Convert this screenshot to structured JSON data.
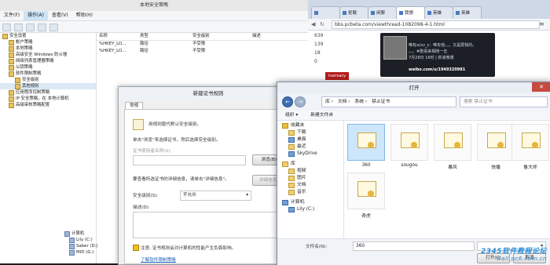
{
  "lsp": {
    "title": "本地安全策略",
    "menu": [
      "文件(F)",
      "操作(A)",
      "查看(V)",
      "帮助(H)"
    ],
    "tree": [
      {
        "label": "安全设置",
        "level": 0
      },
      {
        "label": "帐户策略",
        "level": 1
      },
      {
        "label": "本地策略",
        "level": 1
      },
      {
        "label": "高级安全 Windows 防火墙",
        "level": 1
      },
      {
        "label": "网络列表管理器策略",
        "level": 1
      },
      {
        "label": "公钥策略",
        "level": 1
      },
      {
        "label": "软件限制策略",
        "level": 1
      },
      {
        "label": "安全级别",
        "level": 2
      },
      {
        "label": "其他规则",
        "level": 2
      },
      {
        "label": "应用程序控制策略",
        "level": 1
      },
      {
        "label": "IP 安全策略，在 本地计算机",
        "level": 1
      },
      {
        "label": "高级审核策略配置",
        "level": 1
      }
    ],
    "columns": [
      "名称",
      "类型",
      "安全级别",
      "描述"
    ],
    "rows": [
      {
        "name": "%HKEY_LO...",
        "type": "路径",
        "level": "不受限",
        "desc": ""
      },
      {
        "name": "%HKEY_LO...",
        "type": "路径",
        "level": "不受限",
        "desc": ""
      }
    ],
    "left_tree_bottom": [
      "计算机",
      "Lily (C:)",
      "Saber (D:)",
      "MID (G:)"
    ]
  },
  "cert_rule_dialog": {
    "title": "新建证书规则",
    "tab": "常规",
    "intro": "用规则替代默认安全级别。",
    "hint": "单击\"浏览\"来选择证书，然后选择安全级别。",
    "subject_label": "证书使用者名称(U):",
    "browse_button": "浏览(B)...",
    "details_hint": "要查看所选证书的详细信息，请单击\"详细信息\"。",
    "details_button": "详细信息(S)",
    "level_label": "安全级别(S):",
    "level_value": "不允许",
    "desc_label": "描述(D):",
    "note": "注意: 证书规则会对计算机的性能产生负面影响。",
    "footer": "了解软件限制策略"
  },
  "browser": {
    "tabs": [
      "",
      "拒载",
      "闲聊",
      "我想",
      "英雄",
      "英雄"
    ],
    "url": "bbs.pcbeta.com/viewthread-1082098-4-1.html",
    "nums": [
      "639",
      "139",
      "18",
      "0"
    ],
    "banner_lines": [
      "唯有a(ov_s：唯有他。。。又是屏我的。",
      "。。。#剧看来相随一击",
      "7月28日 16时 | 新浪微博",
      "weibo.com/u/1949320981"
    ],
    "anniversary": "iversary"
  },
  "open_dialog": {
    "title": "打开",
    "breadcrumb": [
      "库",
      "文档",
      "系统",
      "禁止证书"
    ],
    "search_placeholder": "搜索 禁止证书",
    "organize": "组织 ▾",
    "new_folder": "新建文件夹",
    "nav": [
      {
        "label": "收藏夹",
        "icon": "star"
      },
      {
        "label": "下载",
        "icon": "folder"
      },
      {
        "label": "桌面",
        "icon": "blue"
      },
      {
        "label": "最近",
        "icon": "folder"
      },
      {
        "label": "SkyDrive",
        "icon": "blue"
      },
      {
        "label": "库",
        "icon": "folder"
      },
      {
        "label": "视频",
        "icon": "folder"
      },
      {
        "label": "图片",
        "icon": "folder"
      },
      {
        "label": "文档",
        "icon": "folder"
      },
      {
        "label": "音乐",
        "icon": "folder"
      },
      {
        "label": "计算机",
        "icon": "blue"
      },
      {
        "label": "Lily (C:)",
        "icon": "blue"
      }
    ],
    "files": [
      "360",
      "sougou",
      "暴风",
      "快播",
      "鲁大师",
      "奇虎"
    ],
    "filename_label": "文件名(N):",
    "filename_value": "360",
    "filetype": "",
    "open_button": "打开(O)",
    "cancel_button": "取消"
  },
  "watermark": {
    "text": "2345软件教程论坛",
    "url": "wall.pc6.com.cn"
  }
}
